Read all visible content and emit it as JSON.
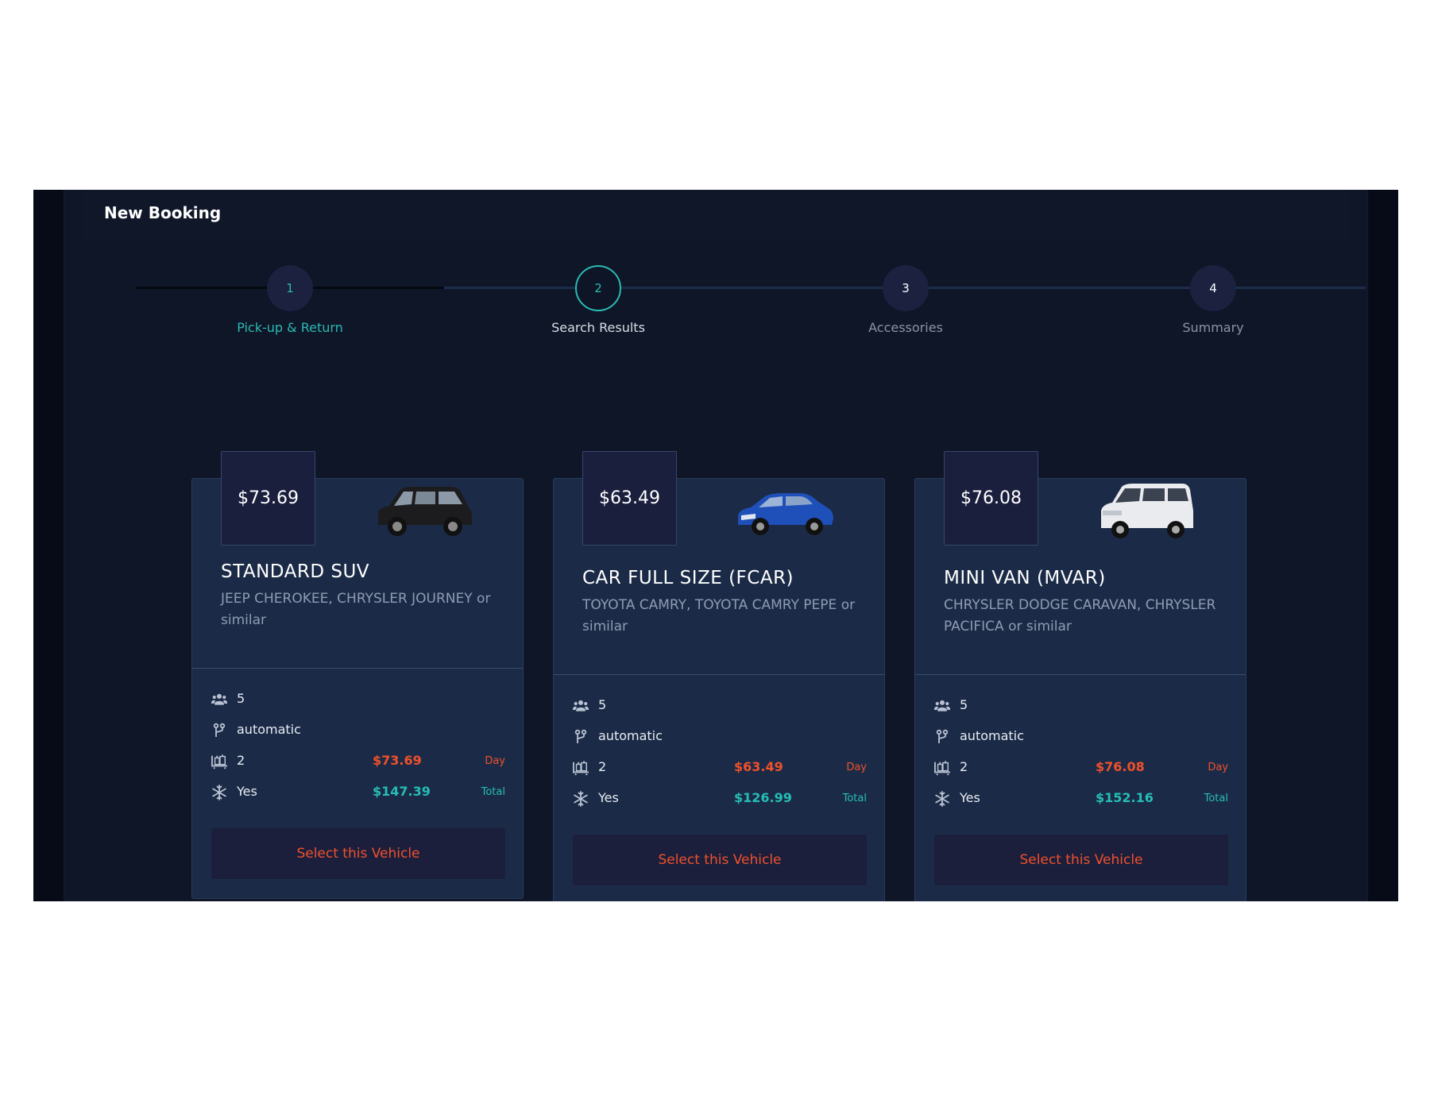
{
  "header": {
    "title": "New Booking"
  },
  "stepper": {
    "steps": [
      {
        "number": "1",
        "label": "Pick-up & Return"
      },
      {
        "number": "2",
        "label": "Search Results"
      },
      {
        "number": "3",
        "label": "Accessories"
      },
      {
        "number": "4",
        "label": "Summary"
      }
    ]
  },
  "vehicles": [
    {
      "price": "$73.69",
      "name": "STANDARD SUV",
      "models": "JEEP CHEROKEE, CHRYSLER JOURNEY or similar",
      "image_icon": "suv-car-icon",
      "car_color": "#1c1c1e",
      "passengers": "5",
      "transmission": "automatic",
      "bags": "2",
      "air_conditioning": "Yes",
      "day_price": "$73.69",
      "day_label": "Day",
      "total_price": "$147.39",
      "total_label": "Total",
      "button_label": "Select this Vehicle"
    },
    {
      "price": "$63.49",
      "name": "CAR FULL SIZE (FCAR)",
      "models": "TOYOTA CAMRY, TOYOTA CAMRY PEPE or similar",
      "image_icon": "sedan-car-icon",
      "car_color": "#1f4fb8",
      "passengers": "5",
      "transmission": "automatic",
      "bags": "2",
      "air_conditioning": "Yes",
      "day_price": "$63.49",
      "day_label": "Day",
      "total_price": "$126.99",
      "total_label": "Total",
      "button_label": "Select this Vehicle"
    },
    {
      "price": "$76.08",
      "name": "MINI VAN (MVAR)",
      "models": "CHRYSLER DODGE CARAVAN, CHRYSLER PACIFICA or similar",
      "image_icon": "minivan-car-icon",
      "car_color": "#e9ebee",
      "passengers": "5",
      "transmission": "automatic",
      "bags": "2",
      "air_conditioning": "Yes",
      "day_price": "$76.08",
      "day_label": "Day",
      "total_price": "$152.16",
      "total_label": "Total",
      "button_label": "Select this Vehicle"
    }
  ],
  "colors": {
    "accent_teal": "#2bb9b4",
    "price_red": "#f0502c",
    "card_bg": "#1b2b47",
    "page_bg": "#0f1627"
  }
}
